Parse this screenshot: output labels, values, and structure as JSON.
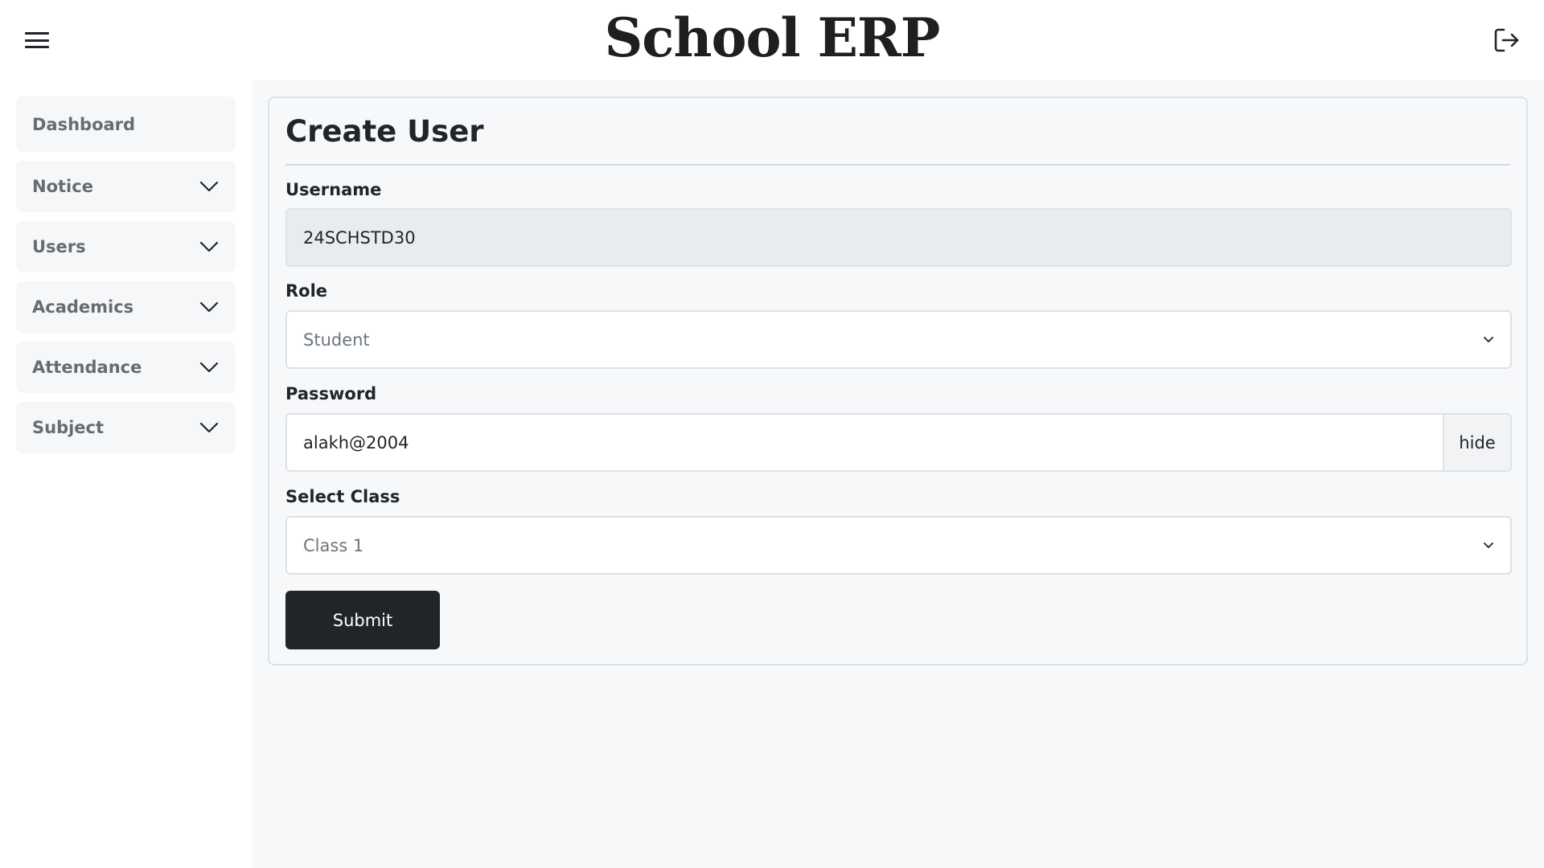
{
  "header": {
    "app_title": "School ERP",
    "menu_icon": "hamburger-menu-icon",
    "logout_icon": "logout-icon"
  },
  "sidebar": {
    "items": [
      {
        "label": "Dashboard",
        "expandable": false
      },
      {
        "label": "Notice",
        "expandable": true
      },
      {
        "label": "Users",
        "expandable": true
      },
      {
        "label": "Academics",
        "expandable": true
      },
      {
        "label": "Attendance",
        "expandable": true
      },
      {
        "label": "Subject",
        "expandable": true
      }
    ]
  },
  "form": {
    "title": "Create User",
    "username": {
      "label": "Username",
      "value": "24SCHSTD30"
    },
    "role": {
      "label": "Role",
      "selected": "Student"
    },
    "password": {
      "label": "Password",
      "value": "alakh@2004",
      "toggle_label": "hide"
    },
    "class": {
      "label": "Select Class",
      "selected": "Class 1"
    },
    "submit_label": "Submit"
  },
  "colors": {
    "primary_button": "#212529",
    "content_background": "#f7f8fa",
    "readonly_field": "#e9ecef"
  }
}
